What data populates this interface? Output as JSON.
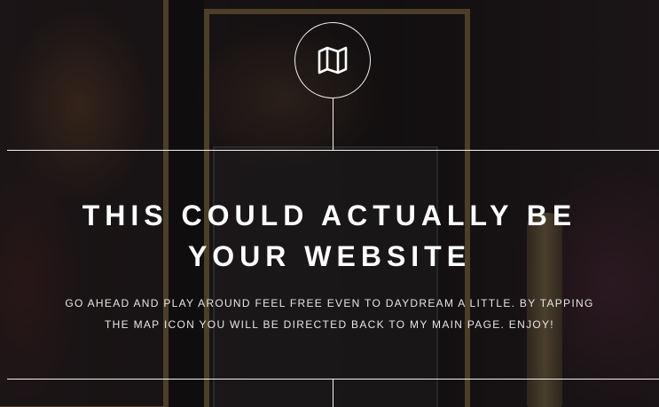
{
  "map_button": {
    "icon": "map-icon"
  },
  "headline": {
    "line1": "THIS COULD ACTUALLY BE",
    "line2": "YOUR WEBSITE"
  },
  "subtext": {
    "line1": "GO AHEAD AND PLAY AROUND FEEL FREE EVEN TO DAYDREAM A LITTLE. BY TAPPING",
    "line2": "THE MAP ICON YOU WILL BE DIRECTED BACK TO MY MAIN PAGE. ENJOY!"
  },
  "colors": {
    "text": "#ffffff",
    "lines": "#f2f2f2",
    "frame": "#8d7444"
  }
}
